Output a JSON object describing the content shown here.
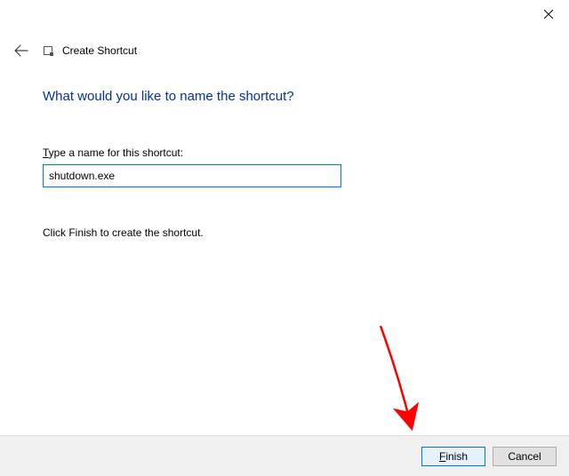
{
  "window": {
    "wizard_title": "Create Shortcut"
  },
  "page": {
    "heading": "What would you like to name the shortcut?",
    "field_label_prefix": "T",
    "field_label_rest": "ype a name for this shortcut:",
    "instruction": "Click Finish to create the shortcut."
  },
  "input": {
    "name_value": "shutdown.exe"
  },
  "buttons": {
    "finish_prefix": "F",
    "finish_rest": "inish",
    "cancel": "Cancel"
  },
  "colors": {
    "accent": "#0078d7",
    "heading": "#003399",
    "annotation": "#ff0000"
  }
}
